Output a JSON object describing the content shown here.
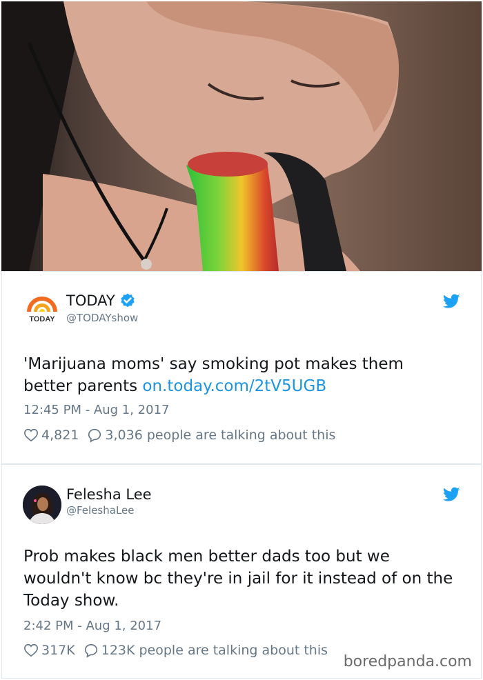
{
  "photo": {
    "alt": ""
  },
  "tweets": [
    {
      "display_name": "TODAY",
      "handle": "@TODAYshow",
      "text": "'Marijuana moms' say smoking pot makes them better parents ",
      "link": "on.today.com/2tV5UGB",
      "timestamp": "12:45 PM - Aug 1, 2017",
      "likes": "4,821",
      "talking": "3,036 people are talking about this",
      "avatar_logo_text": "TODAY"
    },
    {
      "display_name": "Felesha Lee",
      "handle": "@FeleshaLee",
      "text": "Prob makes black men better dads too but we wouldn't know bc they're in jail for it instead of on the Today show.",
      "timestamp": "2:42 PM - Aug 1, 2017",
      "likes": "317K",
      "talking": "123K people are talking about this"
    }
  ],
  "watermark": "boredpanda.com",
  "colors": {
    "link": "#1b95e0",
    "verified": "#1da1f2",
    "bird": "#1da1f2",
    "muted": "#657786"
  }
}
